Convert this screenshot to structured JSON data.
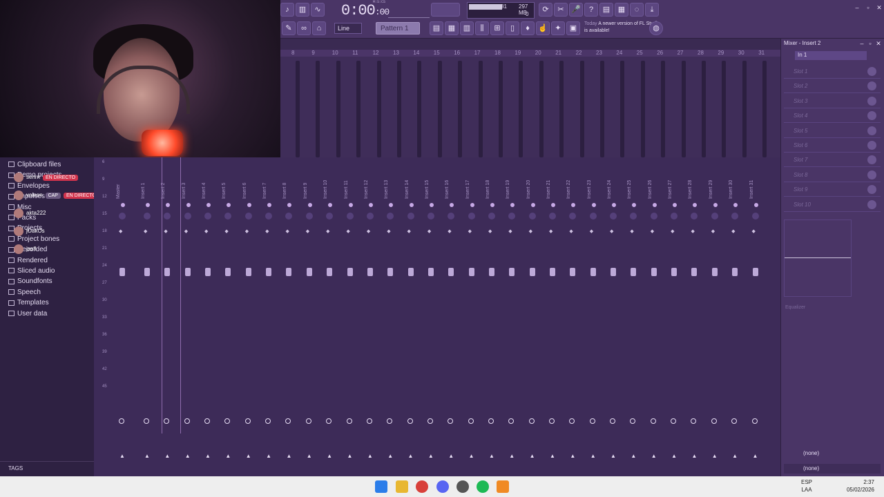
{
  "toolbar": {
    "time_main": "0:00",
    "time_sub": "00",
    "time_unit": "M:S:CS",
    "cpu_value": "81",
    "memory": "297 MB",
    "polyphony": "0",
    "snap_mode": "Line",
    "pattern": "Pattern 1",
    "news_when": "Today",
    "news_text": "A newer version of FL Studio is available!"
  },
  "ruler": [
    "8",
    "9",
    "10",
    "11",
    "12",
    "13",
    "14",
    "15",
    "16",
    "17",
    "18",
    "19",
    "20",
    "21",
    "22",
    "23",
    "24",
    "25",
    "26",
    "27",
    "28",
    "29",
    "30",
    "31"
  ],
  "browser": {
    "items": [
      "Clipboard files",
      "Demo projects",
      "Envelopes",
      "Impulses",
      "Misc",
      "Packs",
      "Projects",
      "Project bones",
      "Recorded",
      "Rendered",
      "Sliced audio",
      "Soundfonts",
      "Speech",
      "Templates",
      "User data"
    ],
    "tags_label": "TAGS"
  },
  "chat_overlay": [
    {
      "user": "senrri",
      "badge": "EN DIRECTO"
    },
    {
      "user": "valeen",
      "badge1": "CAP",
      "badge2": "EN DIRECTO"
    },
    {
      "user": "akta222"
    },
    {
      "user": "jOakOs"
    },
    {
      "user": "jasfl"
    }
  ],
  "mixer": {
    "db_scale": [
      "6",
      "9",
      "12",
      "15",
      "18",
      "21",
      "24",
      "27",
      "30",
      "33",
      "36",
      "39",
      "42",
      "45"
    ],
    "master_label": "Master",
    "inserts": [
      "Insert 1",
      "Insert 2",
      "Insert 3",
      "Insert 4",
      "Insert 5",
      "Insert 6",
      "Insert 7",
      "Insert 8",
      "Insert 9",
      "Insert 10",
      "Insert 11",
      "Insert 12",
      "Insert 13",
      "Insert 14",
      "Insert 15",
      "Insert 16",
      "Insert 17",
      "Insert 18",
      "Insert 19",
      "Insert 20",
      "Insert 21",
      "Insert 22",
      "Insert 23",
      "Insert 24",
      "Insert 25",
      "Insert 26",
      "Insert 27",
      "Insert 28",
      "Insert 29",
      "Insert 30",
      "Insert 31"
    ],
    "selected": "Insert 2"
  },
  "insert_panel": {
    "title": "Mixer - Insert 2",
    "input": "In 1",
    "slots": [
      "Slot 1",
      "Slot 2",
      "Slot 3",
      "Slot 4",
      "Slot 5",
      "Slot 6",
      "Slot 7",
      "Slot 8",
      "Slot 9",
      "Slot 10"
    ],
    "eq_label": "Equalizer",
    "out_none_1": "(none)",
    "out_none_2": "(none)"
  },
  "taskbar": {
    "lang_1": "ESP",
    "lang_2": "LAA",
    "time": "2:37",
    "date": "05/02/2026"
  },
  "colors": {
    "panel": "#4a3566",
    "mixer_bg": "#3d2b58",
    "accent": "#c89ae8"
  }
}
